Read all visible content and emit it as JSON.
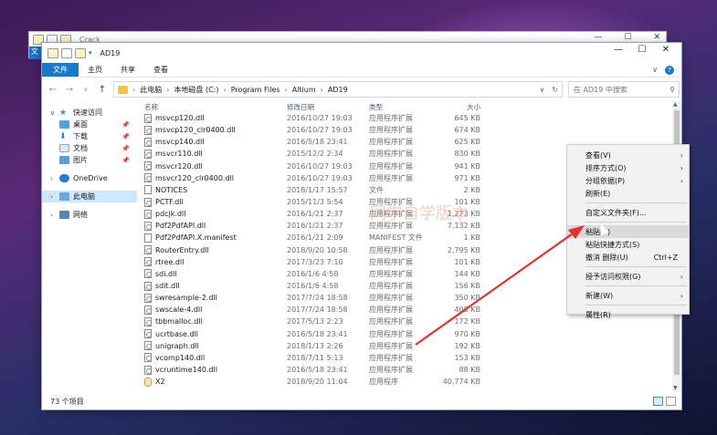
{
  "back_window": {
    "title": "Crack",
    "tab": "文"
  },
  "window": {
    "title": "AD19",
    "controls": [
      "—",
      "☐",
      "✕"
    ]
  },
  "ribbon": {
    "tabs": [
      "文件",
      "主页",
      "共享",
      "查看"
    ]
  },
  "address": {
    "crumbs": [
      "此电脑",
      "本地磁盘 (C:)",
      "Program Files",
      "Altium",
      "AD19"
    ],
    "search_placeholder": "在 AD19 中搜索"
  },
  "nav": {
    "quick_access": "快速访问",
    "pinned": [
      "桌面",
      "下载",
      "文档",
      "图片"
    ],
    "onedrive": "OneDrive",
    "this_pc": "此电脑",
    "network": "网络"
  },
  "columns": [
    "名称",
    "修改日期",
    "类型",
    "大小"
  ],
  "files": [
    {
      "name": "msvcp120.dll",
      "date": "2016/10/27 19:03",
      "type": "应用程序扩展",
      "size": "645 KB",
      "icon": "dll"
    },
    {
      "name": "msvcp120_clr0400.dll",
      "date": "2016/10/27 19:03",
      "type": "应用程序扩展",
      "size": "674 KB",
      "icon": "dll"
    },
    {
      "name": "msvcp140.dll",
      "date": "2016/5/18 23:41",
      "type": "应用程序扩展",
      "size": "625 KB",
      "icon": "dll"
    },
    {
      "name": "msvcr110.dll",
      "date": "2015/12/2 2:34",
      "type": "应用程序扩展",
      "size": "830 KB",
      "icon": "dll"
    },
    {
      "name": "msvcr120.dll",
      "date": "2016/10/27 19:03",
      "type": "应用程序扩展",
      "size": "941 KB",
      "icon": "dll"
    },
    {
      "name": "msvcr120_clr0400.dll",
      "date": "2016/10/27 19:03",
      "type": "应用程序扩展",
      "size": "971 KB",
      "icon": "dll"
    },
    {
      "name": "NOTICES",
      "date": "2018/1/17 15:57",
      "type": "文件",
      "size": "2 KB",
      "icon": "file"
    },
    {
      "name": "PCTF.dll",
      "date": "2015/11/3 5:54",
      "type": "应用程序扩展",
      "size": "101 KB",
      "icon": "dll"
    },
    {
      "name": "pdcjk.dll",
      "date": "2016/1/21 2:37",
      "type": "应用程序扩展",
      "size": "1,273 KB",
      "icon": "dll"
    },
    {
      "name": "Pdf2PdfAPI.dll",
      "date": "2016/1/21 2:37",
      "type": "应用程序扩展",
      "size": "7,132 KB",
      "icon": "dll"
    },
    {
      "name": "Pdf2PdfAPI.X.manifest",
      "date": "2016/1/21 2:09",
      "type": "MANIFEST 文件",
      "size": "1 KB",
      "icon": "file"
    },
    {
      "name": "RouterEntry.dll",
      "date": "2018/9/20 10:58",
      "type": "应用程序扩展",
      "size": "2,795 KB",
      "icon": "dll"
    },
    {
      "name": "rtree.dll",
      "date": "2017/3/23 7:10",
      "type": "应用程序扩展",
      "size": "101 KB",
      "icon": "dll"
    },
    {
      "name": "sdi.dll",
      "date": "2016/1/6 4:58",
      "type": "应用程序扩展",
      "size": "144 KB",
      "icon": "dll"
    },
    {
      "name": "sdit.dll",
      "date": "2016/1/6 4:58",
      "type": "应用程序扩展",
      "size": "156 KB",
      "icon": "dll"
    },
    {
      "name": "swresample-2.dll",
      "date": "2017/7/24 18:58",
      "type": "应用程序扩展",
      "size": "350 KB",
      "icon": "dll"
    },
    {
      "name": "swscale-4.dll",
      "date": "2017/7/24 18:58",
      "type": "应用程序扩展",
      "size": "405 KB",
      "icon": "dll"
    },
    {
      "name": "tbbmalloc.dll",
      "date": "2017/5/13 2:23",
      "type": "应用程序扩展",
      "size": "172 KB",
      "icon": "dll"
    },
    {
      "name": "ucrtbase.dll",
      "date": "2016/5/18 23:41",
      "type": "应用程序扩展",
      "size": "970 KB",
      "icon": "dll"
    },
    {
      "name": "unigraph.dll",
      "date": "2018/1/13 2:26",
      "type": "应用程序扩展",
      "size": "192 KB",
      "icon": "dll"
    },
    {
      "name": "vcomp140.dll",
      "date": "2018/7/11 5:13",
      "type": "应用程序扩展",
      "size": "153 KB",
      "icon": "dll"
    },
    {
      "name": "vcruntime140.dll",
      "date": "2016/5/18 23:41",
      "type": "应用程序扩展",
      "size": "88 KB",
      "icon": "dll"
    },
    {
      "name": "X2",
      "date": "2018/9/20 11:04",
      "type": "应用程序",
      "size": "40,774 KB",
      "icon": "exe"
    }
  ],
  "status": {
    "count": "73 个项目"
  },
  "watermark": "同学自学版本",
  "context_menu": {
    "items": [
      {
        "label": "查看(V)",
        "arrow": true
      },
      {
        "label": "排序方式(O)",
        "arrow": true
      },
      {
        "label": "分组依据(P)",
        "arrow": true
      },
      {
        "label": "刷新(E)"
      },
      {
        "sep": true
      },
      {
        "label": "自定义文件夹(F)..."
      },
      {
        "sep": true
      },
      {
        "label": "粘贴(P)",
        "hover": true
      },
      {
        "label": "粘贴快捷方式(S)"
      },
      {
        "label": "撤消 删除(U)",
        "shortcut": "Ctrl+Z"
      },
      {
        "sep": true
      },
      {
        "label": "授予访问权限(G)",
        "arrow": true
      },
      {
        "sep": true
      },
      {
        "label": "新建(W)",
        "arrow": true
      },
      {
        "sep": true
      },
      {
        "label": "属性(R)"
      }
    ]
  },
  "colors": {
    "accent": "#1979ca",
    "arrow": "#e8302a"
  }
}
